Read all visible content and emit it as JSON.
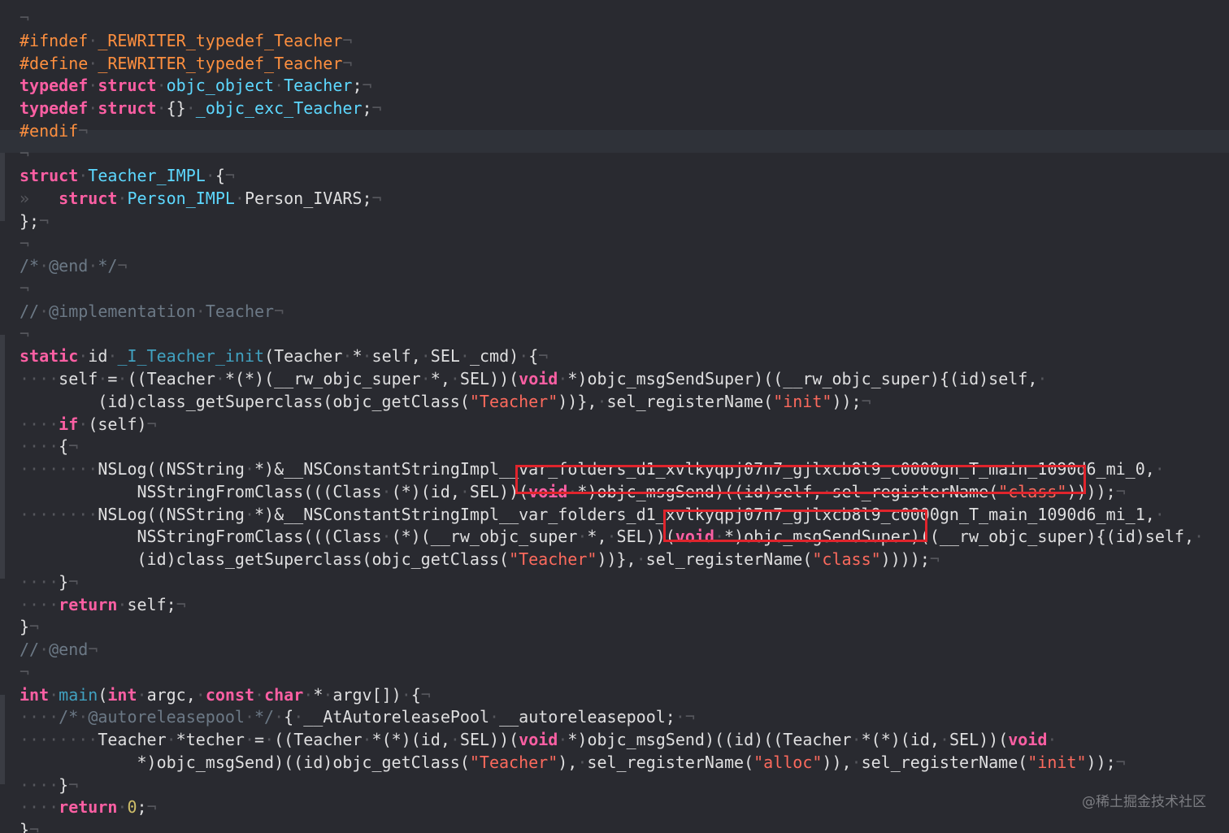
{
  "editor": {
    "theme_colors": {
      "background": "#292a30",
      "keyword": "#fc5fa3",
      "preprocessor": "#fd8f3f",
      "type": "#5dd8ff",
      "function": "#41a1c0",
      "string": "#fc6a5d",
      "number": "#d0bf69",
      "comment": "#6c7986",
      "plain": "#dfdfe0",
      "highlight_box": "#e0242c"
    },
    "watermark": "@稀土掘金技术社区",
    "lines": [
      [
        [
          "ws",
          "¬"
        ]
      ],
      [
        [
          "pre",
          "#ifndef"
        ],
        [
          "ws",
          "·"
        ],
        [
          "pre",
          "_REWRITER_typedef_Teacher"
        ],
        [
          "ws",
          "¬"
        ]
      ],
      [
        [
          "pre",
          "#define"
        ],
        [
          "ws",
          "·"
        ],
        [
          "pre",
          "_REWRITER_typedef_Teacher"
        ],
        [
          "ws",
          "¬"
        ]
      ],
      [
        [
          "kw",
          "typedef"
        ],
        [
          "ws",
          "·"
        ],
        [
          "kw",
          "struct"
        ],
        [
          "ws",
          "·"
        ],
        [
          "type",
          "objc_object"
        ],
        [
          "ws",
          "·"
        ],
        [
          "type",
          "Teacher"
        ],
        [
          "plain",
          ";"
        ],
        [
          "ws",
          "¬"
        ]
      ],
      [
        [
          "kw",
          "typedef"
        ],
        [
          "ws",
          "·"
        ],
        [
          "kw",
          "struct"
        ],
        [
          "ws",
          "·"
        ],
        [
          "plain",
          "{}"
        ],
        [
          "ws",
          "·"
        ],
        [
          "type",
          "_objc_exc_Teacher"
        ],
        [
          "plain",
          ";"
        ],
        [
          "ws",
          "¬"
        ]
      ],
      [
        [
          "pre",
          "#endif"
        ],
        [
          "ws",
          "¬"
        ]
      ],
      [
        [
          "ws",
          "¬"
        ]
      ],
      [
        [
          "kw",
          "struct"
        ],
        [
          "ws",
          "·"
        ],
        [
          "type",
          "Teacher_IMPL"
        ],
        [
          "ws",
          "·"
        ],
        [
          "plain",
          "{"
        ],
        [
          "ws",
          "¬"
        ]
      ],
      [
        [
          "ws",
          "»   "
        ],
        [
          "kw",
          "struct"
        ],
        [
          "ws",
          "·"
        ],
        [
          "type",
          "Person_IMPL"
        ],
        [
          "ws",
          "·"
        ],
        [
          "plain",
          "Person_IVARS;"
        ],
        [
          "ws",
          "¬"
        ]
      ],
      [
        [
          "plain",
          "};"
        ],
        [
          "ws",
          "¬"
        ]
      ],
      [
        [
          "ws",
          "¬"
        ]
      ],
      [
        [
          "cmt",
          "/*"
        ],
        [
          "ws",
          "·"
        ],
        [
          "cmt",
          "@end"
        ],
        [
          "ws",
          "·"
        ],
        [
          "cmt",
          "*/"
        ],
        [
          "ws",
          "¬"
        ]
      ],
      [
        [
          "ws",
          "¬"
        ]
      ],
      [
        [
          "cmt",
          "//"
        ],
        [
          "ws",
          "·"
        ],
        [
          "cmt",
          "@implementation"
        ],
        [
          "ws",
          "·"
        ],
        [
          "cmt",
          "Teacher"
        ],
        [
          "ws",
          "¬"
        ]
      ],
      [
        [
          "ws",
          "¬"
        ]
      ],
      [
        [
          "kw",
          "static"
        ],
        [
          "ws",
          "·"
        ],
        [
          "plain",
          "id"
        ],
        [
          "ws",
          "·"
        ],
        [
          "func",
          "_I_Teacher_init"
        ],
        [
          "plain",
          "(Teacher"
        ],
        [
          "ws",
          "·"
        ],
        [
          "plain",
          "*"
        ],
        [
          "ws",
          "·"
        ],
        [
          "plain",
          "self,"
        ],
        [
          "ws",
          "·"
        ],
        [
          "plain",
          "SEL"
        ],
        [
          "ws",
          "·"
        ],
        [
          "plain",
          "_cmd)"
        ],
        [
          "ws",
          "·"
        ],
        [
          "plain",
          "{"
        ],
        [
          "ws",
          "¬"
        ]
      ],
      [
        [
          "ws",
          "····"
        ],
        [
          "plain",
          "self"
        ],
        [
          "ws",
          "·"
        ],
        [
          "plain",
          "="
        ],
        [
          "ws",
          "·"
        ],
        [
          "plain",
          "((Teacher"
        ],
        [
          "ws",
          "·"
        ],
        [
          "plain",
          "*(*)(__rw_objc_super"
        ],
        [
          "ws",
          "·"
        ],
        [
          "plain",
          "*,"
        ],
        [
          "ws",
          "·"
        ],
        [
          "plain",
          "SEL))("
        ],
        [
          "kw",
          "void"
        ],
        [
          "ws",
          "·"
        ],
        [
          "plain",
          "*)objc_msgSendSuper)((__rw_objc_super){(id)self,"
        ],
        [
          "ws",
          "·"
        ]
      ],
      [
        [
          "plain",
          "        (id)class_getSuperclass(objc_getClass("
        ],
        [
          "str",
          "\"Teacher\""
        ],
        [
          "plain",
          "))},"
        ],
        [
          "ws",
          "·"
        ],
        [
          "plain",
          "sel_registerName("
        ],
        [
          "str",
          "\"init\""
        ],
        [
          "plain",
          "));"
        ],
        [
          "ws",
          "¬"
        ]
      ],
      [
        [
          "ws",
          "····"
        ],
        [
          "kw",
          "if"
        ],
        [
          "ws",
          "·"
        ],
        [
          "plain",
          "(self)"
        ],
        [
          "ws",
          "¬"
        ]
      ],
      [
        [
          "ws",
          "····"
        ],
        [
          "plain",
          "{"
        ],
        [
          "ws",
          "¬"
        ]
      ],
      [
        [
          "ws",
          "········"
        ],
        [
          "plain",
          "NSLog((NSString"
        ],
        [
          "ws",
          "·"
        ],
        [
          "plain",
          "*)&__NSConstantStringImpl__var_folders_d1_xvlkyqpj07n7_gjlxcb8l9_c0000gn_T_main_1090d6_mi_0,"
        ],
        [
          "ws",
          "·"
        ]
      ],
      [
        [
          "plain",
          "            NSStringFromClass(((Class"
        ],
        [
          "ws",
          "·"
        ],
        [
          "plain",
          "(*)(id,"
        ],
        [
          "ws",
          "·"
        ],
        [
          "plain",
          "SEL))("
        ],
        [
          "kw",
          "void"
        ],
        [
          "ws",
          "·"
        ],
        [
          "plain",
          "*)objc_msgSend)((id)self,"
        ],
        [
          "ws",
          "·"
        ],
        [
          "plain",
          "sel_registerName("
        ],
        [
          "str",
          "\"class\""
        ],
        [
          "plain",
          "))));"
        ],
        [
          "ws",
          "¬"
        ]
      ],
      [
        [
          "ws",
          "········"
        ],
        [
          "plain",
          "NSLog((NSString"
        ],
        [
          "ws",
          "·"
        ],
        [
          "plain",
          "*)&__NSConstantStringImpl__var_folders_d1_xvlkyqpj07n7_gjlxcb8l9_c0000gn_T_main_1090d6_mi_1,"
        ],
        [
          "ws",
          "·"
        ]
      ],
      [
        [
          "plain",
          "            NSStringFromClass(((Class"
        ],
        [
          "ws",
          "·"
        ],
        [
          "plain",
          "(*)(__rw_objc_super"
        ],
        [
          "ws",
          "·"
        ],
        [
          "plain",
          "*,"
        ],
        [
          "ws",
          "·"
        ],
        [
          "plain",
          "SEL))("
        ],
        [
          "kw",
          "void"
        ],
        [
          "ws",
          "·"
        ],
        [
          "plain",
          "*)objc_msgSendSuper)((__rw_objc_super){(id)self,"
        ],
        [
          "ws",
          "·"
        ]
      ],
      [
        [
          "plain",
          "            (id)class_getSuperclass(objc_getClass("
        ],
        [
          "str",
          "\"Teacher\""
        ],
        [
          "plain",
          "))},"
        ],
        [
          "ws",
          "·"
        ],
        [
          "plain",
          "sel_registerName("
        ],
        [
          "str",
          "\"class\""
        ],
        [
          "plain",
          "))));"
        ],
        [
          "ws",
          "¬"
        ]
      ],
      [
        [
          "ws",
          "····"
        ],
        [
          "plain",
          "}"
        ],
        [
          "ws",
          "¬"
        ]
      ],
      [
        [
          "ws",
          "····"
        ],
        [
          "kw",
          "return"
        ],
        [
          "ws",
          "·"
        ],
        [
          "plain",
          "self;"
        ],
        [
          "ws",
          "¬"
        ]
      ],
      [
        [
          "plain",
          "}"
        ],
        [
          "ws",
          "¬"
        ]
      ],
      [
        [
          "cmt",
          "//"
        ],
        [
          "ws",
          "·"
        ],
        [
          "cmt",
          "@end"
        ],
        [
          "ws",
          "¬"
        ]
      ],
      [
        [
          "ws",
          "¬"
        ]
      ],
      [
        [
          "kw",
          "int"
        ],
        [
          "ws",
          "·"
        ],
        [
          "func",
          "main"
        ],
        [
          "plain",
          "("
        ],
        [
          "kw",
          "int"
        ],
        [
          "ws",
          "·"
        ],
        [
          "plain",
          "argc,"
        ],
        [
          "ws",
          "·"
        ],
        [
          "kw",
          "const"
        ],
        [
          "ws",
          "·"
        ],
        [
          "kw",
          "char"
        ],
        [
          "ws",
          "·"
        ],
        [
          "plain",
          "*"
        ],
        [
          "ws",
          "·"
        ],
        [
          "plain",
          "argv[])"
        ],
        [
          "ws",
          "·"
        ],
        [
          "plain",
          "{"
        ],
        [
          "ws",
          "¬"
        ]
      ],
      [
        [
          "ws",
          "····"
        ],
        [
          "cmt",
          "/*"
        ],
        [
          "ws",
          "·"
        ],
        [
          "cmt",
          "@autoreleasepool"
        ],
        [
          "ws",
          "·"
        ],
        [
          "cmt",
          "*/"
        ],
        [
          "ws",
          "·"
        ],
        [
          "plain",
          "{"
        ],
        [
          "ws",
          "·"
        ],
        [
          "plain",
          "__AtAutoreleasePool"
        ],
        [
          "ws",
          "·"
        ],
        [
          "plain",
          "__autoreleasepool;"
        ],
        [
          "ws",
          "·¬"
        ]
      ],
      [
        [
          "ws",
          "········"
        ],
        [
          "plain",
          "Teacher"
        ],
        [
          "ws",
          "·"
        ],
        [
          "plain",
          "*techer"
        ],
        [
          "ws",
          "·"
        ],
        [
          "plain",
          "="
        ],
        [
          "ws",
          "·"
        ],
        [
          "plain",
          "((Teacher"
        ],
        [
          "ws",
          "·"
        ],
        [
          "plain",
          "*(*)(id,"
        ],
        [
          "ws",
          "·"
        ],
        [
          "plain",
          "SEL))("
        ],
        [
          "kw",
          "void"
        ],
        [
          "ws",
          "·"
        ],
        [
          "plain",
          "*)objc_msgSend)((id)((Teacher"
        ],
        [
          "ws",
          "·"
        ],
        [
          "plain",
          "*(*)(id,"
        ],
        [
          "ws",
          "·"
        ],
        [
          "plain",
          "SEL))("
        ],
        [
          "kw",
          "void"
        ],
        [
          "ws",
          "·"
        ]
      ],
      [
        [
          "plain",
          "            *)objc_msgSend)((id)objc_getClass("
        ],
        [
          "str",
          "\"Teacher\""
        ],
        [
          "plain",
          "),"
        ],
        [
          "ws",
          "·"
        ],
        [
          "plain",
          "sel_registerName("
        ],
        [
          "str",
          "\"alloc\""
        ],
        [
          "plain",
          ")),"
        ],
        [
          "ws",
          "·"
        ],
        [
          "plain",
          "sel_registerName("
        ],
        [
          "str",
          "\"init\""
        ],
        [
          "plain",
          "));"
        ],
        [
          "ws",
          "¬"
        ]
      ],
      [
        [
          "ws",
          "····"
        ],
        [
          "plain",
          "}"
        ],
        [
          "ws",
          "¬"
        ]
      ],
      [
        [
          "ws",
          "····"
        ],
        [
          "kw",
          "return"
        ],
        [
          "ws",
          "·"
        ],
        [
          "num",
          "0"
        ],
        [
          "plain",
          ";"
        ],
        [
          "ws",
          "¬"
        ]
      ],
      [
        [
          "plain",
          "}"
        ],
        [
          "ws",
          "¬"
        ]
      ]
    ]
  }
}
